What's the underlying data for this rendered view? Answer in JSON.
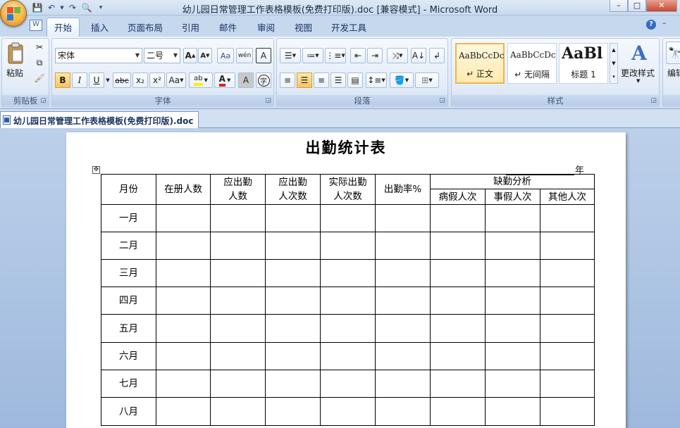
{
  "window": {
    "title": "幼儿园日常管理工作表格模板(免费打印版).doc [兼容模式] - Microsoft Word",
    "controls": {
      "minimize": "–",
      "maximize": "□",
      "close": "✕"
    }
  },
  "ribbon_tabs": [
    "开始",
    "插入",
    "页面布局",
    "引用",
    "邮件",
    "审阅",
    "视图",
    "开发工具"
  ],
  "active_tab": "开始",
  "clipboard": {
    "paste": "粘贴",
    "group_label": "剪贴板"
  },
  "font": {
    "name": "宋体",
    "size": "二号",
    "group_label": "字体",
    "buttons": {
      "grow": "A",
      "shrink": "A",
      "bold": "B",
      "italic": "I",
      "underline": "U",
      "strike": "abc",
      "subscript": "x₂",
      "superscript": "x²",
      "change_case": "Aa",
      "font_color": "A",
      "char_shade": "A",
      "phonetic": "wén",
      "char_border": "A",
      "enclose": "字"
    }
  },
  "paragraph": {
    "group_label": "段落"
  },
  "styles": {
    "group_label": "样式",
    "tiles": [
      {
        "sample": "AaBbCcDc",
        "name": "↵ 正文"
      },
      {
        "sample": "AaBbCcDc",
        "name": "↵ 无间隔"
      },
      {
        "sample": "AaBl",
        "name": "标题 1"
      }
    ],
    "change_styles": "更改样式",
    "edit": "编辑"
  },
  "document_tab": "幼儿园日常管理工作表格模板(免费打印版).doc",
  "document": {
    "title": "出勤统计表",
    "year_suffix": "年",
    "table": {
      "headers": {
        "month": "月份",
        "enrolled": "在册人数",
        "expected_people_1": "应出勤",
        "expected_people_2": "人数",
        "expected_times_1": "应出勤",
        "expected_times_2": "人次数",
        "actual_1": "实际出勤",
        "actual_2": "人次数",
        "rate": "出勤率%",
        "absence": "缺勤分析",
        "sick": "病假人次",
        "personal": "事假人次",
        "other": "其他人次"
      },
      "months": [
        "一月",
        "二月",
        "三月",
        "四月",
        "五月",
        "六月",
        "七月",
        "八月"
      ]
    }
  }
}
